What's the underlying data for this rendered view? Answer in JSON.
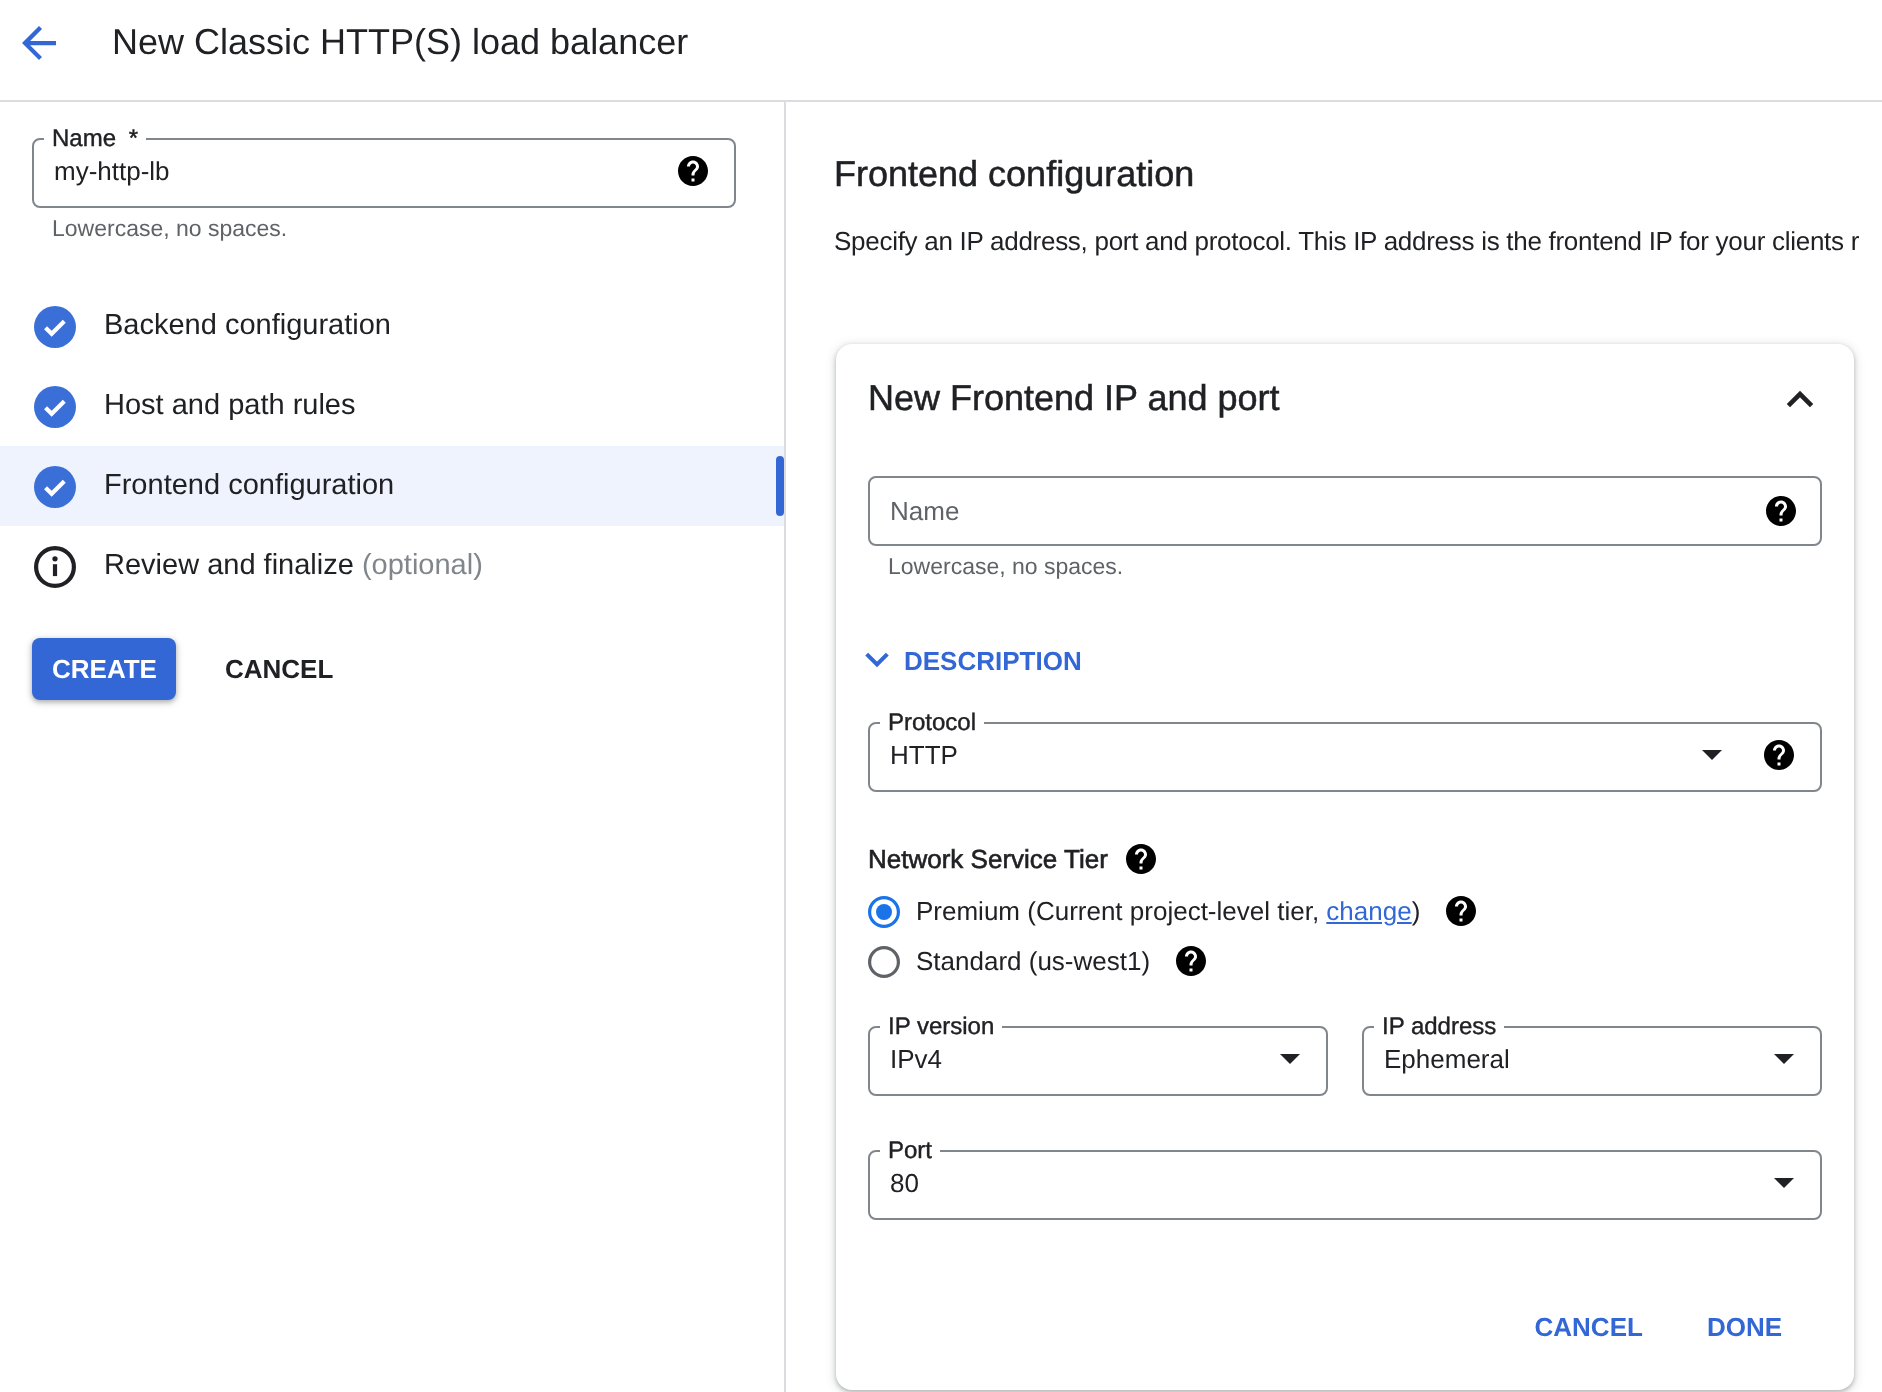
{
  "header": {
    "title": "New Classic HTTP(S) load balancer"
  },
  "sidebar": {
    "name_field": {
      "label": "Name",
      "required_mark": "*",
      "value": "my-http-lb",
      "hint": "Lowercase, no spaces.",
      "help": true
    },
    "steps": [
      {
        "label": "Backend configuration",
        "kind": "done",
        "selected": false
      },
      {
        "label": "Host and path rules",
        "kind": "done",
        "selected": false
      },
      {
        "label": "Frontend configuration",
        "kind": "done",
        "selected": true
      },
      {
        "label": "Review and finalize",
        "note": "(optional)",
        "kind": "info",
        "selected": false
      }
    ],
    "buttons": [
      {
        "label": "CREATE",
        "kind": "primary"
      },
      {
        "label": "CANCEL",
        "kind": "text"
      }
    ]
  },
  "main": {
    "title": "Frontend configuration",
    "description": "Specify an IP address, port and protocol. This IP address is the frontend IP for your clients r",
    "card": {
      "title": "New Frontend IP and port",
      "expanded": true,
      "name_field": {
        "placeholder": "Name",
        "hint": "Lowercase, no spaces.",
        "help": true
      },
      "description_toggle": {
        "label": "DESCRIPTION",
        "expanded": false
      },
      "protocol": {
        "label": "Protocol",
        "value": "HTTP",
        "help": true
      },
      "network_tier": {
        "label": "Network Service Tier",
        "help": true,
        "options": [
          {
            "label": "Premium (Current project-level tier, ",
            "link": "change",
            "label_end": ")",
            "selected": true,
            "help": true
          },
          {
            "label": "Standard (us-west1)",
            "selected": false,
            "help": true
          }
        ]
      },
      "ip_fields": [
        {
          "label": "IP version",
          "value": "IPv4"
        },
        {
          "label": "IP address",
          "value": "Ephemeral"
        }
      ],
      "port": {
        "label": "Port",
        "value": "80"
      },
      "buttons": [
        {
          "label": "CANCEL",
          "kind": "text"
        },
        {
          "label": "DONE",
          "kind": "text"
        }
      ]
    }
  }
}
